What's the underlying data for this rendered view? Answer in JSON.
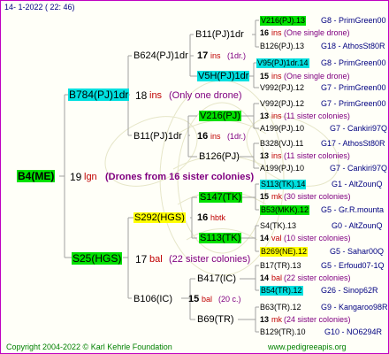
{
  "header": {
    "date": "14- 1-2022 ( 22: 46)"
  },
  "footer": {
    "copyright": "Copyright 2004-2022 © Karl Kehrle Foundation",
    "site": "www.pedigreeapis.org"
  },
  "colors": {
    "frame": "#c000c0",
    "green": "#00e000",
    "cyan": "#00e0e0",
    "yellow": "#ffff00",
    "line": "#a0a0a0"
  },
  "root": {
    "name": "B4(ME)",
    "year": "19",
    "suffix": "lgn",
    "note": "(Drones from 16 sister colonies)"
  },
  "gen1": {
    "upper": {
      "name": "B784(PJ)1dr",
      "year": "18",
      "suffix": "ins",
      "note": "(Only one drone)"
    },
    "lower": {
      "name": "S25(HGS)",
      "year": "17",
      "suffix": "bal",
      "note": "(22 sister colonies)"
    }
  },
  "gen2": [
    {
      "name": "B624(PJ)1dr",
      "year": "17",
      "suffix": "ins",
      "note": "(1dr.)"
    },
    {
      "name": "B11(PJ)1dr",
      "year": "16",
      "suffix": "ins",
      "note": "(1dr.)"
    },
    {
      "name": "S292(HGS)",
      "year": "16",
      "suffix": "hbtk",
      "note": ""
    },
    {
      "name": "B106(IC)",
      "year": "15",
      "suffix": "bal",
      "note": "(20 c.)"
    }
  ],
  "gen3": [
    {
      "name": "B11(PJ)1dr"
    },
    {
      "name": "V5H(PJ)1dr"
    },
    {
      "name": "V216(PJ)"
    },
    {
      "name": "B126(PJ)"
    },
    {
      "name": "S147(TK)"
    },
    {
      "name": "S113(TK)"
    },
    {
      "name": "B417(IC)"
    },
    {
      "name": "B69(TR)"
    }
  ],
  "gen4": [
    {
      "parent": "V216(PJ).13",
      "year": "16",
      "suffix": "ins",
      "note": "(One single drone)",
      "mother": "B126(PJ).13",
      "b1": "G8 - PrimGreen00",
      "b2": "G18 - AthosSt80R"
    },
    {
      "parent": "V95(PJ)1dr.14",
      "year": "15",
      "suffix": "ins",
      "note": "(One single drone)",
      "mother": "V992(PJ).12",
      "b1": "G8 - PrimGreen00",
      "b2": "G7 - PrimGreen00"
    },
    {
      "parent": "V992(PJ).12",
      "year": "13",
      "suffix": "ins",
      "note": "(11 sister colonies)",
      "mother": "A199(PJ).10",
      "b1": "G7 - PrimGreen00",
      "b2": "G7 - Cankiri97Q"
    },
    {
      "parent": "B328(VJ).11",
      "year": "13",
      "suffix": "ins",
      "note": "(11 sister colonies)",
      "mother": "A199(PJ).10",
      "b1": "G17 - AthosSt80R",
      "b2": "G7 - Cankiri97Q"
    },
    {
      "parent": "S113(TK).14",
      "year": "15",
      "suffix": "mk",
      "note": "(30 sister colonies)",
      "mother": "B53(MKK).12",
      "b1": "G1 - AltZounQ",
      "b2": "G5 - Gr.R.mounta"
    },
    {
      "parent": "S4(TK).13",
      "year": "14",
      "suffix": "val",
      "note": "(10 sister colonies)",
      "mother": "B269(NE).12",
      "b1": "G0 - AltZounQ",
      "b2": "G5 - Sahar00Q"
    },
    {
      "parent": "B17(TR).13",
      "year": "14",
      "suffix": "bal",
      "note": "(22 sister colonies)",
      "mother": "B54(TR).12",
      "b1": "G5 - Erfoud07-1Q",
      "b2": "G26 - Sinop62R"
    },
    {
      "parent": "B63(TR).12",
      "year": "13",
      "suffix": "mk",
      "note": "(24 sister colonies)",
      "mother": "B129(TR).10",
      "b1": "G9 - Kangaroo98R",
      "b2": "G10 - NO6294R"
    }
  ]
}
